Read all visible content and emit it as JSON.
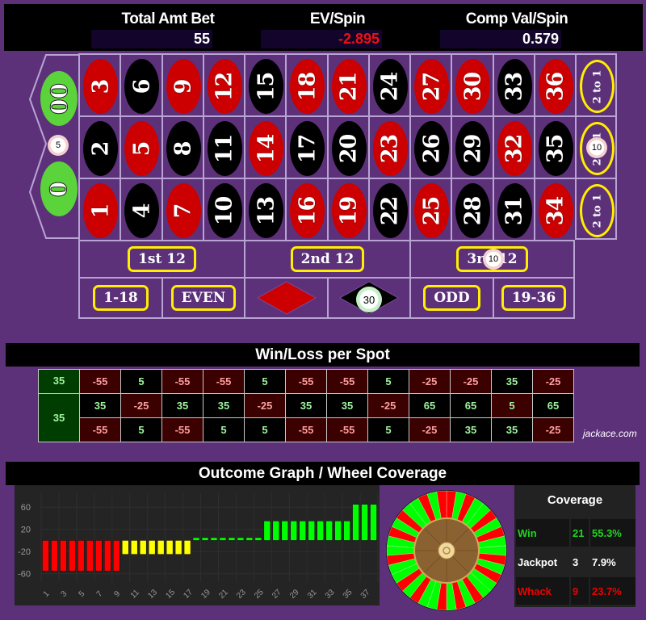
{
  "stats": {
    "total_bet": {
      "label": "Total Amt Bet",
      "value": "55"
    },
    "ev_spin": {
      "label": "EV/Spin",
      "value": "-2.895"
    },
    "comp_val": {
      "label": "Comp Val/Spin",
      "value": "0.579"
    }
  },
  "board": {
    "zeros": [
      {
        "label": "00"
      },
      {
        "label": "0"
      }
    ],
    "rows": [
      [
        {
          "n": "3",
          "c": "red"
        },
        {
          "n": "6",
          "c": "black"
        },
        {
          "n": "9",
          "c": "red"
        },
        {
          "n": "12",
          "c": "red"
        },
        {
          "n": "15",
          "c": "black"
        },
        {
          "n": "18",
          "c": "red"
        },
        {
          "n": "21",
          "c": "red"
        },
        {
          "n": "24",
          "c": "black"
        },
        {
          "n": "27",
          "c": "red"
        },
        {
          "n": "30",
          "c": "red"
        },
        {
          "n": "33",
          "c": "black"
        },
        {
          "n": "36",
          "c": "red"
        }
      ],
      [
        {
          "n": "2",
          "c": "black"
        },
        {
          "n": "5",
          "c": "red"
        },
        {
          "n": "8",
          "c": "black"
        },
        {
          "n": "11",
          "c": "black"
        },
        {
          "n": "14",
          "c": "red"
        },
        {
          "n": "17",
          "c": "black"
        },
        {
          "n": "20",
          "c": "black"
        },
        {
          "n": "23",
          "c": "red"
        },
        {
          "n": "26",
          "c": "black"
        },
        {
          "n": "29",
          "c": "black"
        },
        {
          "n": "32",
          "c": "red"
        },
        {
          "n": "35",
          "c": "black"
        }
      ],
      [
        {
          "n": "1",
          "c": "red"
        },
        {
          "n": "4",
          "c": "black"
        },
        {
          "n": "7",
          "c": "red"
        },
        {
          "n": "10",
          "c": "black"
        },
        {
          "n": "13",
          "c": "black"
        },
        {
          "n": "16",
          "c": "red"
        },
        {
          "n": "19",
          "c": "red"
        },
        {
          "n": "22",
          "c": "black"
        },
        {
          "n": "25",
          "c": "red"
        },
        {
          "n": "28",
          "c": "black"
        },
        {
          "n": "31",
          "c": "black"
        },
        {
          "n": "34",
          "c": "red"
        }
      ]
    ],
    "columns_label": "2 to 1",
    "dozens": [
      "1st 12",
      "2nd 12",
      "3rd 12"
    ],
    "even_money": [
      "1-18",
      "EVEN",
      "RED",
      "BLACK",
      "ODD",
      "19-36"
    ],
    "chips": {
      "split_0_00": "5",
      "column_2": "10",
      "dozen_3": "10",
      "black": "30"
    },
    "colors": {
      "red": "#cc0000",
      "black": "#000000",
      "green": "#5bd33a",
      "felt": "#5c317a",
      "accent": "#ffee00"
    }
  },
  "winloss": {
    "title": "Win/Loss per Spot",
    "zeros": [
      "35",
      "35"
    ],
    "rows": [
      [
        -55,
        5,
        -55,
        -55,
        5,
        -55,
        -55,
        5,
        -25,
        -25,
        35,
        -25
      ],
      [
        35,
        -25,
        35,
        35,
        -25,
        35,
        35,
        -25,
        65,
        65,
        5,
        65
      ],
      [
        -55,
        5,
        -55,
        5,
        5,
        -55,
        -55,
        5,
        -25,
        35,
        35,
        -25
      ]
    ],
    "watermark": "jackace.com"
  },
  "outcome": {
    "title": "Outcome Graph / Wheel Coverage",
    "coverage": {
      "title": "Coverage",
      "rows": [
        {
          "label": "Win",
          "count": "21",
          "pct": "55.3%",
          "color": "#1fd61f"
        },
        {
          "label": "Jackpot",
          "count": "3",
          "pct": "7.9%",
          "color": "#ffffff"
        },
        {
          "label": "Whack",
          "count": "9",
          "pct": "23.7%",
          "color": "#ee0000"
        }
      ]
    },
    "wheel": {
      "pockets": 38,
      "win_color": "#00ff00",
      "loss_color": "#ff0000"
    }
  },
  "chart_data": {
    "type": "bar",
    "title": "",
    "xlabel": "",
    "ylabel": "",
    "x": [
      1,
      2,
      3,
      4,
      5,
      6,
      7,
      8,
      9,
      10,
      11,
      12,
      13,
      14,
      15,
      16,
      17,
      18,
      19,
      20,
      21,
      22,
      23,
      24,
      25,
      26,
      27,
      28,
      29,
      30,
      31,
      32,
      33,
      34,
      35,
      36,
      37,
      38
    ],
    "x_tick_labels": [
      "1",
      "3",
      "5",
      "7",
      "9",
      "11",
      "13",
      "15",
      "17",
      "19",
      "21",
      "23",
      "25",
      "27",
      "29",
      "31",
      "33",
      "35",
      "37"
    ],
    "values": [
      -55,
      -55,
      -55,
      -55,
      -55,
      -55,
      -55,
      -55,
      -55,
      -25,
      -25,
      -25,
      -25,
      -25,
      -25,
      -25,
      -25,
      5,
      5,
      5,
      5,
      5,
      5,
      5,
      5,
      35,
      35,
      35,
      35,
      35,
      35,
      35,
      35,
      35,
      35,
      65,
      65,
      65
    ],
    "bar_colors": {
      "-55": "#ff0000",
      "-25": "#ffff00",
      "5": "#00ff00",
      "35": "#00ff00",
      "65": "#00ff00"
    },
    "y_ticks": [
      60,
      20,
      -20,
      -60
    ],
    "ylim": [
      -75,
      85
    ],
    "grid": true,
    "legend": "none"
  }
}
